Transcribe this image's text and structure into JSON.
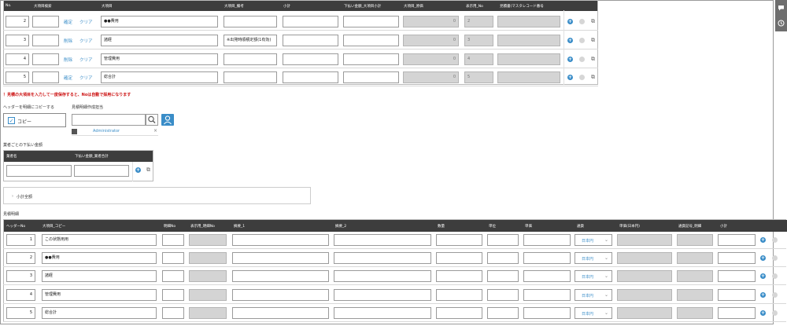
{
  "top_table": {
    "headers": [
      "No.",
      "大項目検索",
      "大項目",
      "大項目_備考",
      "小計",
      "下払い金額_大項目小計",
      "大項目_原価",
      "表示用_No",
      "見積書(マスタレコード番号"
    ],
    "rows": [
      {
        "no": "2",
        "confirm": "確定",
        "clear": "クリア",
        "name": "●●費用",
        "memo": "",
        "total": "0",
        "disp": "2"
      },
      {
        "no": "3",
        "confirm": "削除",
        "clear": "クリア",
        "name": "諸経",
        "memo": "※出発時順積定額(1有効)",
        "total": "0",
        "disp": "3"
      },
      {
        "no": "4",
        "confirm": "削除",
        "clear": "クリア",
        "name": "管理費用",
        "memo": "",
        "total": "0",
        "disp": "4"
      },
      {
        "no": "5",
        "confirm": "確定",
        "clear": "クリア",
        "name": "総合計",
        "memo": "",
        "total": "0",
        "disp": "5"
      }
    ]
  },
  "warning": "！見積の大項目を入力して一度保存すると、Noは自動で採用になります",
  "header_copy": {
    "label": "ヘッダーを明細にコピーする",
    "checkbox_label": "コピー",
    "checked": true
  },
  "assignee": {
    "label": "見積明細作成担当",
    "search_placeholder": "",
    "selected_user": "Administrator",
    "remove": "×"
  },
  "subcontract": {
    "label": "業者ごとの下払い金額",
    "headers": [
      "業者名",
      "下払い金額_業者合計"
    ]
  },
  "subtotal_toggle": "小計全額",
  "detail": {
    "label": "見積明細",
    "headers": [
      "ヘッダーNo",
      "大項目_コピー",
      "明細No",
      "表示用_明細No",
      "摘要_1",
      "摘要_2",
      "数量",
      "単位",
      "単価",
      "通貨",
      "単価(日本円)",
      "通貨記号_明細",
      "小計"
    ],
    "rows": [
      {
        "no": "1",
        "name": "この状態用用",
        "currency": "日本円"
      },
      {
        "no": "2",
        "name": "●●費用",
        "currency": "日本円"
      },
      {
        "no": "3",
        "name": "諸経",
        "currency": "日本円"
      },
      {
        "no": "4",
        "name": "管理費用",
        "currency": "日本円"
      },
      {
        "no": "5",
        "name": "総合計",
        "currency": "日本円"
      }
    ]
  },
  "side_icons": [
    "chat-icon",
    "history-icon"
  ]
}
